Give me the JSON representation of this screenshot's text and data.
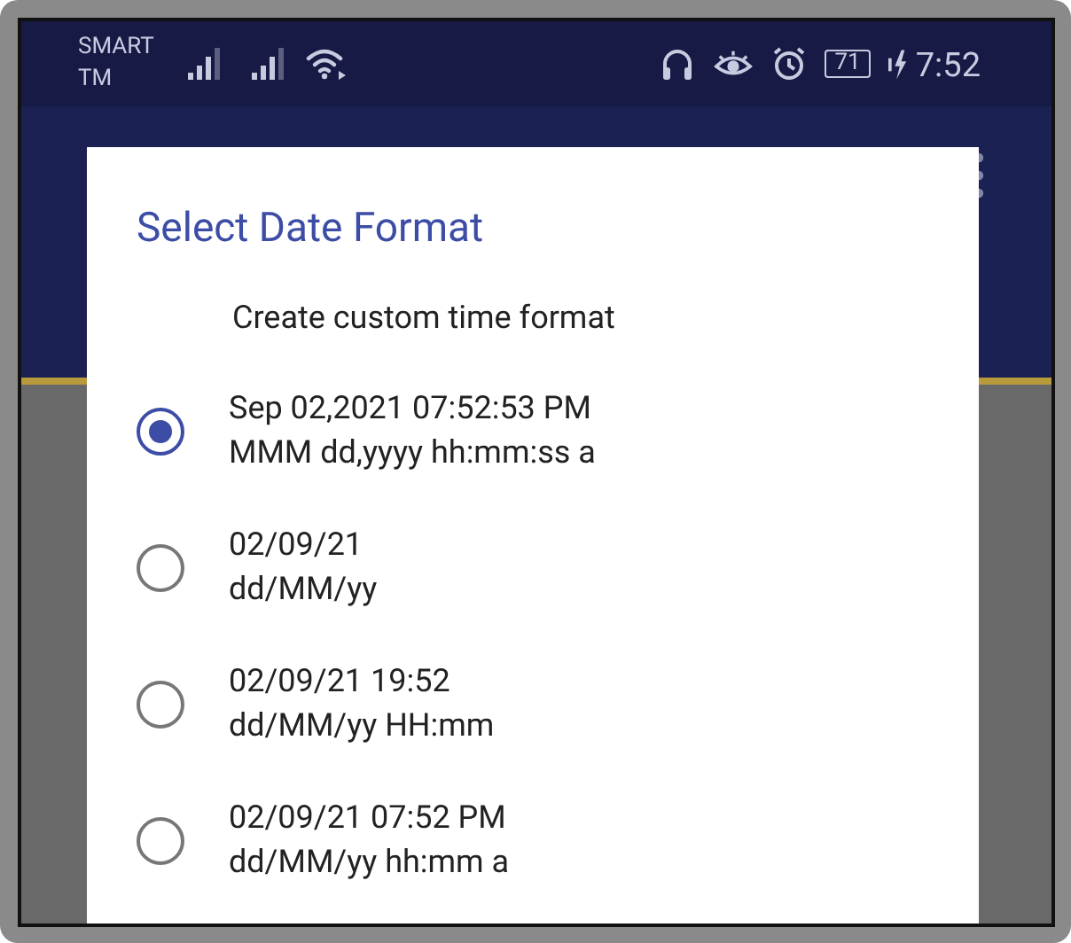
{
  "status_bar": {
    "carrier_lines": [
      "SMART",
      "TM"
    ],
    "battery": "71",
    "time": "7:52"
  },
  "dialog": {
    "title": "Select Date Format",
    "custom_option": "Create custom time format",
    "options": [
      {
        "example": "Sep 02,2021 07:52:53 PM",
        "pattern": "MMM dd,yyyy hh:mm:ss a",
        "selected": true
      },
      {
        "example": "02/09/21",
        "pattern": "dd/MM/yy",
        "selected": false
      },
      {
        "example": "02/09/21 19:52",
        "pattern": "dd/MM/yy HH:mm",
        "selected": false
      },
      {
        "example": "02/09/21 07:52 PM",
        "pattern": "dd/MM/yy hh:mm a",
        "selected": false
      }
    ]
  }
}
